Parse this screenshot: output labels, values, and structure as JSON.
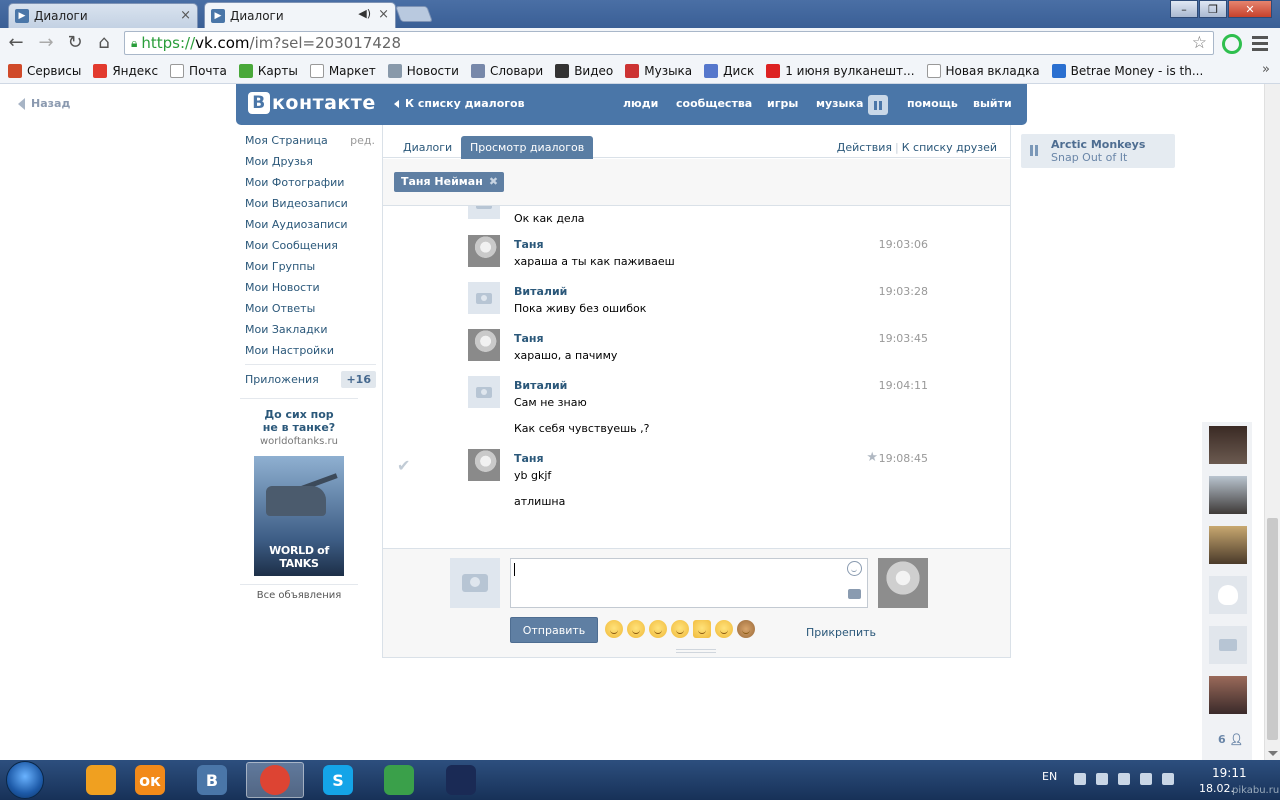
{
  "browser": {
    "tabs": [
      {
        "title": "Диалоги",
        "active": false
      },
      {
        "title": "Диалоги",
        "active": true
      }
    ],
    "url": {
      "scheme": "https://",
      "host": "vk.com",
      "path": "/im?sel=203017428"
    },
    "bookmarks": [
      {
        "label": "Сервисы",
        "icon": "apps-grid-icon",
        "color": "#d04a2a"
      },
      {
        "label": "Яндекс",
        "icon": "yandex-icon",
        "color": "#e23a2e"
      },
      {
        "label": "Почта",
        "icon": "page-icon",
        "color": "#ffffff"
      },
      {
        "label": "Карты",
        "icon": "maps-icon",
        "color": "#49a83a"
      },
      {
        "label": "Маркет",
        "icon": "page-icon",
        "color": "#ffffff"
      },
      {
        "label": "Новости",
        "icon": "news-icon",
        "color": "#8899aa"
      },
      {
        "label": "Словари",
        "icon": "dictionary-icon",
        "color": "#7788aa"
      },
      {
        "label": "Видео",
        "icon": "video-icon",
        "color": "#333333"
      },
      {
        "label": "Музыка",
        "icon": "music-icon",
        "color": "#cc3333"
      },
      {
        "label": "Диск",
        "icon": "disk-icon",
        "color": "#5577cc"
      },
      {
        "label": "1 июня вулканешт...",
        "icon": "youtube-icon",
        "color": "#dd2222"
      },
      {
        "label": "Новая вкладка",
        "icon": "page-icon",
        "color": "#ffffff"
      },
      {
        "label": "Betrae Money - is th...",
        "icon": "b-icon",
        "color": "#2a6fd0"
      }
    ]
  },
  "vk": {
    "back_label": "Назад",
    "logo_text": "контакте",
    "logo_letter": "В",
    "to_dialogs": "К списку диалогов",
    "topnav": [
      {
        "label": "люди"
      },
      {
        "label": "сообщества"
      },
      {
        "label": "игры"
      },
      {
        "label": "музыка"
      },
      {
        "label": "помощь"
      },
      {
        "label": "выйти"
      }
    ],
    "left_menu": [
      {
        "label": "Моя Страница",
        "extra": "ред."
      },
      {
        "label": "Мои Друзья"
      },
      {
        "label": "Мои Фотографии"
      },
      {
        "label": "Мои Видеозаписи"
      },
      {
        "label": "Мои Аудиозаписи"
      },
      {
        "label": "Мои Сообщения"
      },
      {
        "label": "Мои Группы"
      },
      {
        "label": "Мои Новости"
      },
      {
        "label": "Мои Ответы"
      },
      {
        "label": "Мои Закладки"
      },
      {
        "label": "Мои Настройки"
      }
    ],
    "apps": {
      "label": "Приложения",
      "count": "+16"
    },
    "ad": {
      "title_line1": "До сих пор",
      "title_line2": "не в танке?",
      "domain": "worldoftanks.ru",
      "image_caption": "WORLD of TANKS",
      "all_ads": "Все объявления"
    }
  },
  "dialog": {
    "tabs": [
      {
        "label": "Диалоги",
        "active": false
      },
      {
        "label": "Просмотр диалогов",
        "active": true
      }
    ],
    "actions": "Действия",
    "friends_list": "К списку друзей",
    "person_chip": "Таня Нейман",
    "messages": [
      {
        "author": "",
        "lines": [
          "Ок как дела"
        ],
        "time": "",
        "avatar": "camera"
      },
      {
        "author": "Таня",
        "lines": [
          "хараша а ты как паживаеш"
        ],
        "time": "19:03:06",
        "avatar": "tanya"
      },
      {
        "author": "Виталий",
        "lines": [
          "Пока живу без ошибок"
        ],
        "time": "19:03:28",
        "avatar": "camera"
      },
      {
        "author": "Таня",
        "lines": [
          "харашо, а пачиму"
        ],
        "time": "19:03:45",
        "avatar": "tanya"
      },
      {
        "author": "Виталий",
        "lines": [
          "Сам не знаю",
          "Как себя чувствуешь ,?"
        ],
        "time": "19:04:11",
        "avatar": "camera"
      },
      {
        "author": "Таня",
        "lines": [
          "yb gkjf",
          "атлишна"
        ],
        "time": "19:08:45",
        "avatar": "tanya"
      }
    ],
    "composer": {
      "input_value": "",
      "send_label": "Отправить",
      "attach_label": "Прикрепить"
    }
  },
  "audio": {
    "artist": "Arctic Monkeys",
    "title": "Snap Out of It"
  },
  "friends_online": "6",
  "taskbar": {
    "apps": [
      {
        "name": "candy-crush-icon",
        "color": "#f0a020",
        "glyph": ""
      },
      {
        "name": "odnoklassniki-icon",
        "color": "#f28a1a",
        "glyph": "ок"
      },
      {
        "name": "vk-app-icon",
        "color": "#4a76a8",
        "glyph": "В"
      },
      {
        "name": "chrome-icon",
        "color": "#dd4433",
        "glyph": ""
      },
      {
        "name": "skype-icon",
        "color": "#14a4e8",
        "glyph": "S"
      },
      {
        "name": "shield-app-icon",
        "color": "#3aa04a",
        "glyph": ""
      },
      {
        "name": "spider-icon",
        "color": "#1a2a55",
        "glyph": ""
      }
    ],
    "lang": "EN",
    "time": "19:11",
    "date": "18.02.",
    "watermark": "pikabu.ru"
  }
}
